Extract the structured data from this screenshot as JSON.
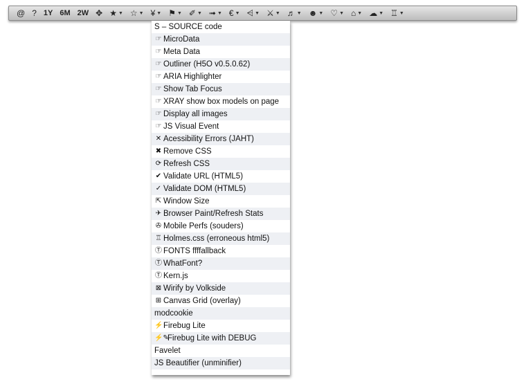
{
  "toolbar": {
    "items": [
      {
        "icon": "@",
        "icon_name": "at-icon",
        "arrow": false
      },
      {
        "icon": "?",
        "icon_name": "help-icon",
        "arrow": false
      },
      {
        "label": "1Y"
      },
      {
        "label": "6M"
      },
      {
        "label": "2W"
      },
      {
        "icon": "✥",
        "icon_name": "move-icon",
        "arrow": false
      },
      {
        "icon": "★",
        "icon_name": "star-filled-icon",
        "arrow": true
      },
      {
        "icon": "☆",
        "icon_name": "star-outline-icon",
        "arrow": true
      },
      {
        "icon": "¥",
        "icon_name": "yen-icon",
        "arrow": true
      },
      {
        "icon": "⚑",
        "icon_name": "flag-icon",
        "arrow": true
      },
      {
        "icon": "✐",
        "icon_name": "pencil-icon",
        "arrow": true
      },
      {
        "icon": "➟",
        "icon_name": "arrow-right-icon",
        "arrow": true
      },
      {
        "icon": "€",
        "icon_name": "euro-icon",
        "arrow": true
      },
      {
        "icon": "⩤",
        "icon_name": "less-than-icon",
        "arrow": true
      },
      {
        "icon": "⚔",
        "icon_name": "crossed-swords-icon",
        "arrow": true
      },
      {
        "icon": "♬",
        "icon_name": "music-icon",
        "arrow": true
      },
      {
        "icon": "☻",
        "icon_name": "face-avatar-icon",
        "arrow": true
      },
      {
        "icon": "♡",
        "icon_name": "heart-icon",
        "arrow": true
      },
      {
        "icon": "⌂",
        "icon_name": "home-icon",
        "arrow": true
      },
      {
        "icon": "☁",
        "icon_name": "cloud-icon",
        "arrow": true
      },
      {
        "icon": "♖",
        "icon_name": "tower-icon",
        "arrow": true
      }
    ]
  },
  "menu": {
    "items": [
      {
        "icon": "",
        "label": "S – SOURCE code"
      },
      {
        "icon": "☞",
        "label": "MicroData"
      },
      {
        "icon": "☞",
        "label": "Meta Data"
      },
      {
        "icon": "☞",
        "label": "Outliner (H5O v0.5.0.62)"
      },
      {
        "icon": "☞",
        "label": "ARIA Highlighter"
      },
      {
        "icon": "☞",
        "label": "Show Tab Focus"
      },
      {
        "icon": "☞",
        "label": "XRAY show box models on page"
      },
      {
        "icon": "☞",
        "label": "Display all images"
      },
      {
        "icon": "☞",
        "label": "JS Visual Event"
      },
      {
        "icon": "✕",
        "label": "Acessibility Errors (JAHT)"
      },
      {
        "icon": "✖",
        "label": "Remove CSS"
      },
      {
        "icon": "⟳",
        "label": "Refresh CSS"
      },
      {
        "icon": "✔",
        "label": "Validate URL (HTML5)"
      },
      {
        "icon": "✓",
        "label": "Validate DOM (HTML5)"
      },
      {
        "icon": "⇱",
        "label": "Window Size"
      },
      {
        "icon": "✈",
        "label": "Browser Paint/Refresh Stats"
      },
      {
        "icon": "✇",
        "label": "Mobile Perfs (souders)"
      },
      {
        "icon": "♖",
        "label": "Holmes.css (erroneous html5)"
      },
      {
        "icon": "Ⓣ",
        "label": "FONTS ffffallback"
      },
      {
        "icon": "Ⓣ",
        "label": "WhatFont?"
      },
      {
        "icon": "Ⓣ",
        "label": "Kern.js"
      },
      {
        "icon": "⊠",
        "label": "Wirify by Volkside"
      },
      {
        "icon": "⊞",
        "label": "Canvas Grid (overlay)"
      },
      {
        "icon": "",
        "label": "modcookie"
      },
      {
        "icon": "⚡",
        "label": "Firebug Lite"
      },
      {
        "icon": "⚡✎",
        "label": "Firebug Lite with DEBUG"
      },
      {
        "icon": "",
        "label": "Favelet"
      },
      {
        "icon": "",
        "label": "JS Beautifier (unminifier)"
      }
    ]
  }
}
